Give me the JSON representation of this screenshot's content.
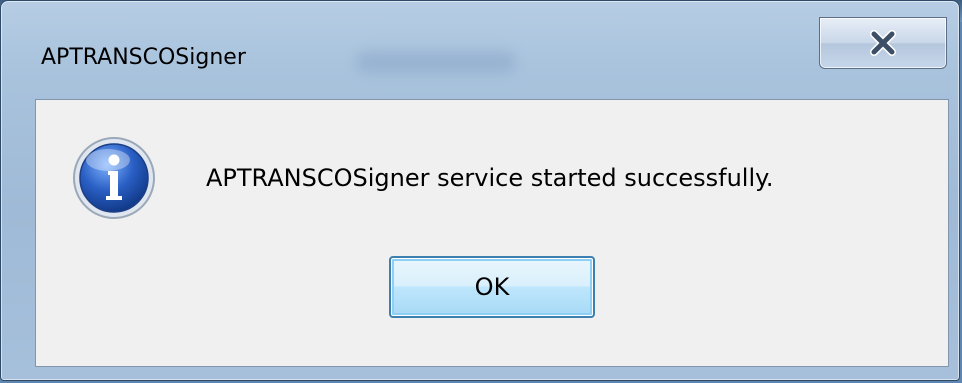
{
  "dialog": {
    "title": "APTRANSCOSigner",
    "message": "APTRANSCOSigner service started successfully.",
    "icon": "information-icon",
    "buttons": {
      "ok_label": "OK"
    },
    "close_icon": "close-icon"
  },
  "colors": {
    "frame": "#a9c3dd",
    "client_background": "#f0f0f0",
    "ok_button_border": "#3c7fb1",
    "info_icon": "#2a5fc4"
  }
}
